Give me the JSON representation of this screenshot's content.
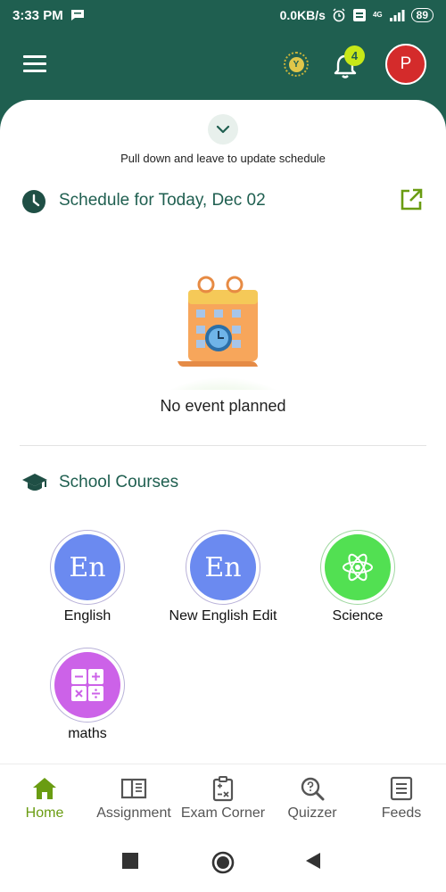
{
  "status_bar": {
    "time": "3:33 PM",
    "net_speed": "0.0KB/s",
    "network": "4G",
    "battery": "89"
  },
  "app_bar": {
    "coin_letter": "Y",
    "notification_count": "4",
    "avatar_initial": "P"
  },
  "schedule": {
    "pull_hint": "Pull down and leave to update schedule",
    "title": "Schedule for Today, Dec 02",
    "empty_message": "No event planned"
  },
  "courses": {
    "title": "School Courses",
    "items": [
      {
        "label": "English",
        "icon_text": "En",
        "icon": "letters-icon",
        "color": "#6b8af0"
      },
      {
        "label": "New English Edit",
        "icon_text": "En",
        "icon": "letters-icon",
        "color": "#6b8af0"
      },
      {
        "label": "Science",
        "icon_text": "",
        "icon": "atom-icon",
        "color": "#52e052"
      },
      {
        "label": "maths",
        "icon_text": "",
        "icon": "calculator-icon",
        "color": "#cc62e8"
      }
    ]
  },
  "bottom_nav": {
    "items": [
      {
        "label": "Home",
        "icon": "home-icon",
        "active": true
      },
      {
        "label": "Assignment",
        "icon": "book-icon",
        "active": false
      },
      {
        "label": "Exam Corner",
        "icon": "clipboard-icon",
        "active": false
      },
      {
        "label": "Quizzer",
        "icon": "quiz-search-icon",
        "active": false
      },
      {
        "label": "Feeds",
        "icon": "feed-icon",
        "active": false
      }
    ]
  },
  "colors": {
    "primary": "#1f5f50",
    "accent": "#6a9c12",
    "avatar": "#d42b2b",
    "badge": "#c7e818"
  }
}
